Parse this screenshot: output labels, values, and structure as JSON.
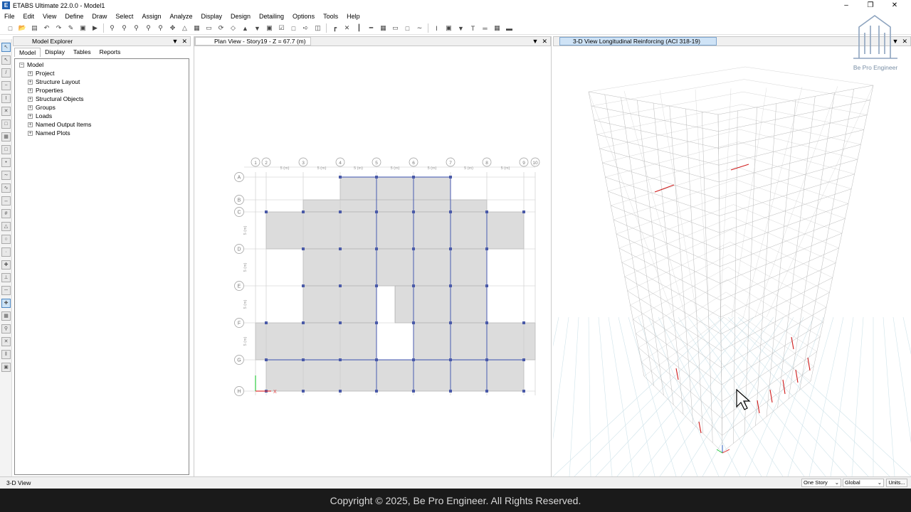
{
  "window": {
    "title": "ETABS Ultimate 22.0.0 - Model1",
    "app_icon": "E"
  },
  "menu": [
    "File",
    "Edit",
    "View",
    "Define",
    "Draw",
    "Select",
    "Assign",
    "Analyze",
    "Display",
    "Design",
    "Detailing",
    "Options",
    "Tools",
    "Help"
  ],
  "explorer": {
    "title": "Model Explorer",
    "tabs": [
      "Model",
      "Display",
      "Tables",
      "Reports"
    ],
    "root": "Model",
    "items": [
      "Project",
      "Structure Layout",
      "Properties",
      "Structural Objects",
      "Groups",
      "Loads",
      "Named Output Items",
      "Named Plots"
    ]
  },
  "plan_view": {
    "title": "Plan View - Story19 - Z = 67.7 (m)",
    "column_bubbles": [
      "10",
      "9",
      "8",
      "7",
      "6",
      "5",
      "4",
      "3",
      "2",
      "1"
    ],
    "row_bubbles": [
      "A",
      "B",
      "C",
      "D",
      "E",
      "F",
      "G",
      "H"
    ],
    "dim_label": "5 (m)",
    "origin_label": "X"
  },
  "view_3d": {
    "title": "3-D View  Longitudinal Reinforcing  (ACI 318-19)"
  },
  "status": {
    "text": "3-D View",
    "story_select": "One Story",
    "coord_select": "Global",
    "units_button": "Units..."
  },
  "logo": {
    "text": "Be Pro Engineer",
    "monogram": "BPE"
  },
  "footer": "Copyright © 2025, Be Pro Engineer. All Rights Reserved.",
  "colors": {
    "accent": "#1f5fb0",
    "beam_blue": "#3a4fae",
    "slab_gray": "#dcdcdc",
    "rebar_red": "#d01c1c"
  }
}
